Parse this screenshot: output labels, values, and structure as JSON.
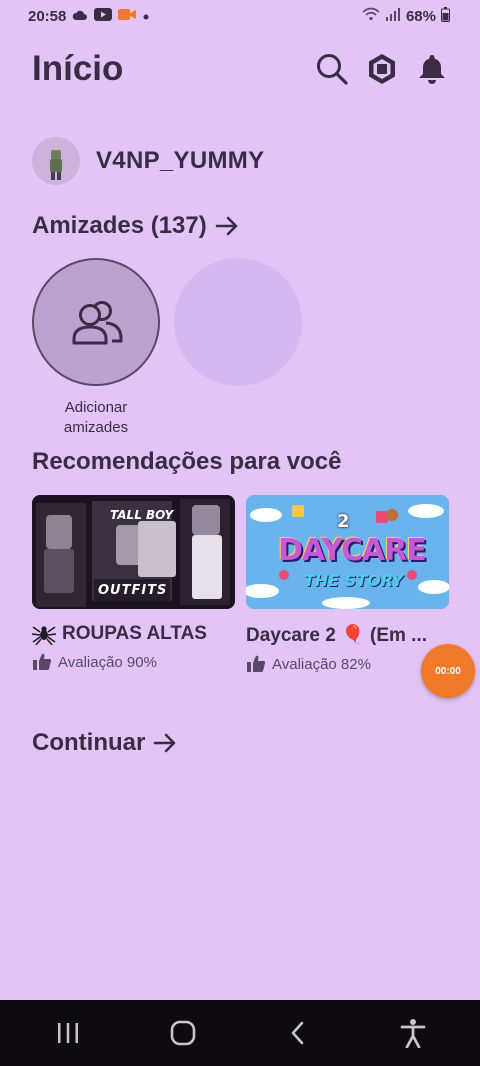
{
  "status_bar": {
    "time": "20:58",
    "battery": "68%"
  },
  "header": {
    "title": "Início"
  },
  "profile": {
    "username": "V4NP_YUMMY"
  },
  "friends": {
    "title": "Amizades (137)",
    "add_label_line1": "Adicionar",
    "add_label_line2": "amizades"
  },
  "recommendations": {
    "title": "Recomendações para você",
    "games": [
      {
        "name": "ROUPAS ALTAS",
        "rating": "Avaliação 90%",
        "thumb_text_top": "TALL BOY",
        "thumb_text_bottom": "OUTFITS"
      },
      {
        "name": "Daycare 2 🎈 (Em ...",
        "rating": "Avaliação 82%",
        "thumb_text_top": "DAYCARE",
        "thumb_text_bottom": "THE STORY",
        "thumb_number": "2"
      }
    ]
  },
  "continue": {
    "title": "Continuar"
  },
  "timer_badge": "00:00",
  "colors": {
    "background": "#e3c4f6",
    "text": "#3a2c45",
    "accent_orange": "#f07a2a",
    "nav_bar": "#0e0b10"
  }
}
